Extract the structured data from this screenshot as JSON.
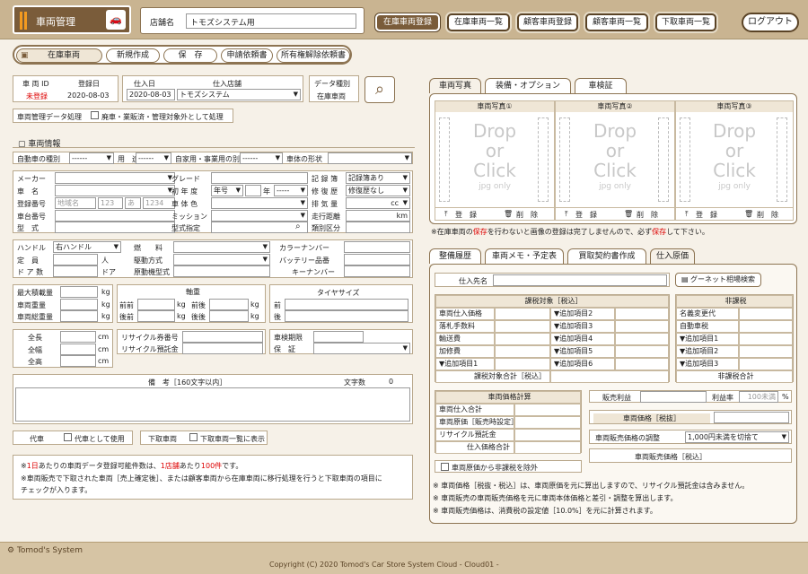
{
  "header": {
    "app_title": "車両管理",
    "shop_label": "店舗名",
    "shop_value": "トモズシステム用",
    "nav": [
      "在庫車両登録",
      "在庫車両一覧",
      "顧客車両登録",
      "顧客車両一覧",
      "下取車両一覧"
    ],
    "logout": "ログアウト"
  },
  "toolbar": {
    "current": "在庫車両",
    "buttons": [
      "新規作成",
      "保　存",
      "申請依頼書",
      "所有権解除依頼書"
    ]
  },
  "vehicle": {
    "id_label": "車 両 ID",
    "id_value": "未登録",
    "reg_date_label": "登録日",
    "reg_date_value": "2020-08-03",
    "buy_date_label": "仕入日",
    "buy_date_value": "2020-08-03",
    "buy_shop_label": "仕入店舗",
    "buy_shop_value": "トモズシステム",
    "data_type_label": "データ種別",
    "data_type_value": "在庫車両",
    "mgmt_label": "車両管理データ処理",
    "mgmt_check": "廃車・業販済・管理対象外として処理"
  },
  "info": {
    "section": "車両情報",
    "auto_type": "自動車の種別",
    "auto_type_v": "------",
    "use": "用　途",
    "use_v": "------",
    "private": "自家用・事業用の別",
    "private_v": "------",
    "shape": "車体の形状",
    "maker": "メーカー",
    "grade": "グレード",
    "record": "記 録 簿",
    "record_v": "記録簿あり",
    "name": "車　名",
    "first_year": "初 年 度",
    "year_v": "年号",
    "nen": "年",
    "month_v": "-----",
    "repair": "修 復 歴",
    "repair_v": "修復歴なし",
    "regno": "登録番号",
    "regno_area": "地域名",
    "regno_class": "123",
    "regno_kana": "あ",
    "regno_num": "1234",
    "color": "車 体 色",
    "displacement": "排 気 量",
    "cc": "cc",
    "chassis": "車台番号",
    "mission": "ミッション",
    "mileage": "走行距離",
    "km": "km",
    "model": "型　式",
    "model_spec": "型式指定",
    "class_div": "類別区分"
  },
  "spec": {
    "handle": "ハンドル",
    "handle_v": "右ハンドル",
    "capacity": "定　員",
    "person": "人",
    "doors": "ド ア 数",
    "door_u": "ドア",
    "fuel": "燃　　料",
    "drive": "駆動方式",
    "engine": "原動機型式",
    "color_no": "カラーナンバー",
    "battery": "バッテリー品番",
    "key_no": "キーナンバー"
  },
  "weight": {
    "max_load": "最大積載量",
    "veh_weight": "車両重量",
    "gross_weight": "車両総重量",
    "kg": "kg",
    "axle": "軸重",
    "front_front": "前前",
    "front_rear": "前後",
    "rear_front": "後前",
    "rear_rear": "後後",
    "tire": "タイヤサイズ",
    "front": "前",
    "rear": "後"
  },
  "size": {
    "length": "全長",
    "width": "全幅",
    "height": "全高",
    "cm": "cm",
    "recycle_no": "リサイクル券番号",
    "recycle_dep": "リサイクル預託金",
    "inspection": "車検期限",
    "warranty": "保　証"
  },
  "remarks": {
    "label": "備　考［160文字以内］",
    "count_label": "文字数",
    "count": "0"
  },
  "subst": {
    "label": "代車",
    "check": "代車として使用"
  },
  "tradein": {
    "label": "下取車両",
    "check": "下取車両一覧に表示"
  },
  "notes": {
    "n1a": "※",
    "n1b": "1日",
    "n1c": "あたりの車両データ登録可能件数は、",
    "n1d": "1店舗",
    "n1e": "あたり",
    "n1f": "100件",
    "n1g": "です。",
    "n2": "※車両販売で下取された車両［売上確定後］、または顧客車両から在庫車両に移行処理を行うと下取車両の項目に",
    "n3": "チェックが入ります。"
  },
  "photo_tabs": [
    "車両写真",
    "装備・オプション",
    "車検証"
  ],
  "photos": [
    {
      "title": "車両写真①"
    },
    {
      "title": "車両写真②"
    },
    {
      "title": "車両写真③"
    }
  ],
  "drop": {
    "l1": "Drop",
    "l2": "or",
    "l3": "Click",
    "l4": "jpg only",
    "reg": "登　録",
    "del": "削　除"
  },
  "photo_note": {
    "a": "※在庫車両の",
    "b": "保存",
    "c": "を行わないと画像の登録は完了しませんので、必ず",
    "d": "保存",
    "e": "して下さい。"
  },
  "cost_tabs": [
    "整備履歴",
    "車両メモ・予定表",
    "買取契約書作成",
    "仕入原価"
  ],
  "cost": {
    "supplier": "仕入先名",
    "goonet": "グーネット相場検索",
    "taxed_head": "課税対象［税込］",
    "taxed_rows": [
      "車両仕入価格",
      "落札手数料",
      "輸送費",
      "加修費",
      "▼追加項目1"
    ],
    "taxed_add": [
      "▼追加項目2",
      "▼追加項目3",
      "▼追加項目4",
      "▼追加項目5",
      "▼追加項目6"
    ],
    "taxed_total": "課税対象合計［税込］",
    "free_head": "非課税",
    "free_rows": [
      "名義変更代",
      "自動車税",
      "▼追加項目1",
      "▼追加項目2",
      "▼追加項目3"
    ],
    "free_total": "非課税合計",
    "calc_head": "車両価格計算",
    "calc_rows": [
      "車両仕入合計",
      "車両原価［販売時設定］",
      "リサイクル預託金"
    ],
    "calc_total": "仕入価格合計",
    "profit": "販売利益",
    "margin": "利益率",
    "margin_v": "100未満",
    "pct": "%",
    "price_label": "車両価格［税抜］",
    "adjust": "車両販売価格の調整",
    "adjust_v": "1,000円未満を切捨て",
    "sale_price": "車両販売価格［税込］",
    "exclude": "車両原価から非課税を除外"
  },
  "cost_notes": [
    "※ 車両価格［税抜・税込］は、車両原価を元に算出しますので、リサイクル預託金は含みません。",
    "※ 車両販売の車両販売価格を元に車両本体価格と差引・調整を算出します。",
    "※ 車両販売価格は、消費税の設定値［10.0%］を元に計算されます。"
  ],
  "footer": {
    "brand": "Tomod's System",
    "copyright": "Copyright (C) 2020 Tomod's Car Store System Cloud - Cloud01 -"
  },
  "colors": {
    "brand": "#7a5c3a",
    "accent": "#f39a20",
    "alert": "#dd0000"
  }
}
